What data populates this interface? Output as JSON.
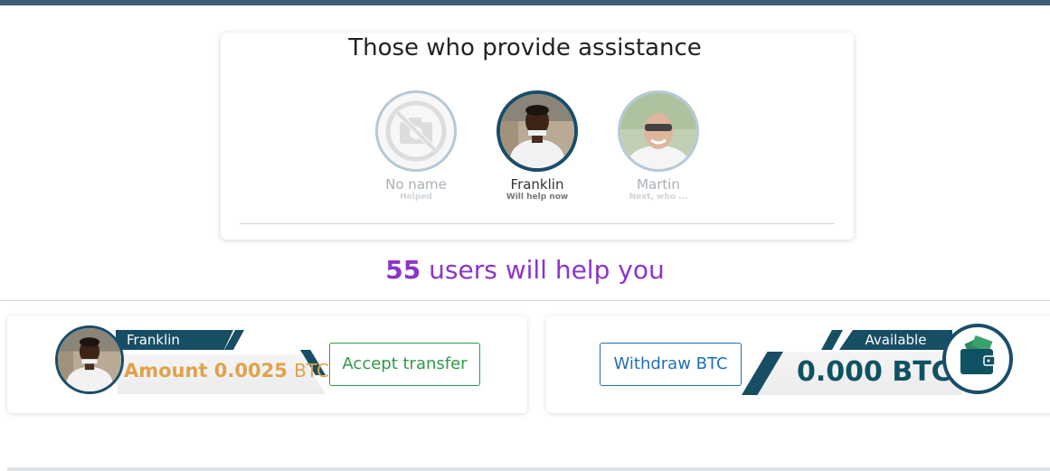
{
  "helpers": {
    "title": "Those who provide assistance",
    "items": [
      {
        "name": "No name",
        "status": "Helped"
      },
      {
        "name": "Franklin",
        "status": "Will help now"
      },
      {
        "name": "Martin",
        "status": "Next, who ..."
      }
    ]
  },
  "summary": {
    "count": "55",
    "text": " users will help you"
  },
  "transfer": {
    "helper_name": "Franklin",
    "amount_label": "Amount 0.0025",
    "amount_unit": "BTC",
    "accept_label": "Accept transfer"
  },
  "wallet": {
    "withdraw_label": "Withdraw BTC",
    "available_label": "Available",
    "balance": "0.000 BTC",
    "icon": "wallet-icon"
  },
  "colors": {
    "brand_dark": "#174e63",
    "accent_purple": "#8a35c9",
    "amount_gold": "#e0a24a",
    "accept_green": "#2e9a46",
    "withdraw_blue": "#1f6fb5"
  }
}
